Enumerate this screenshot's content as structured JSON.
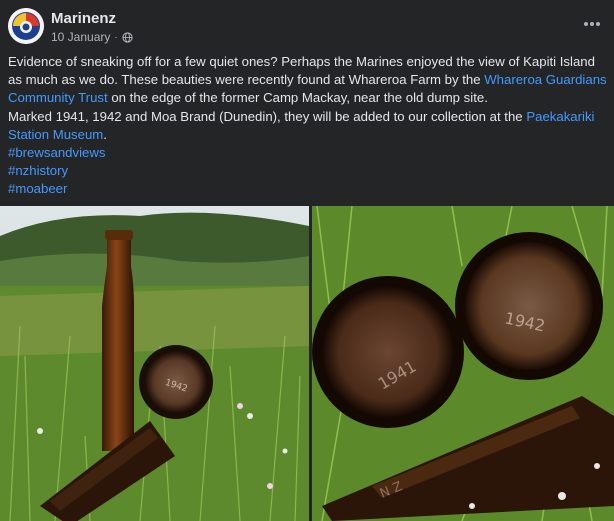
{
  "post": {
    "author": "Marinenz",
    "date": "10 January",
    "separator": "·",
    "body": {
      "line1_prefix": "Evidence of sneaking off for a few quiet ones? Perhaps the Marines enjoyed the view of Kapiti Island as much as we do. These beauties were recently found at Whareroa Farm by the ",
      "link1": "Whareroa Guardians Community Trust",
      "line1_suffix": " on the edge of the former Camp Mackay, near the old dump site.",
      "line2_prefix": "Marked 1941, 1942 and Moa Brand (Dunedin), they will be added to our collection at the ",
      "link2": "Paekakariki Station Museum",
      "line2_suffix": "."
    },
    "hashtags": [
      "#brewsandviews",
      "#nzhistory",
      "#moabeer"
    ]
  },
  "icons": {
    "privacy": "globe-icon",
    "more": "more-options-icon",
    "avatar": "marines-logo"
  },
  "photos": {
    "left_bottle_mark": "1942",
    "right_bottle_mark_1": "1941",
    "right_bottle_mark_2": "1942",
    "right_bottle_side_text": "N Z"
  },
  "colors": {
    "background": "#242526",
    "text": "#e4e6eb",
    "secondary_text": "#b0b3b8",
    "link": "#4599ff"
  }
}
